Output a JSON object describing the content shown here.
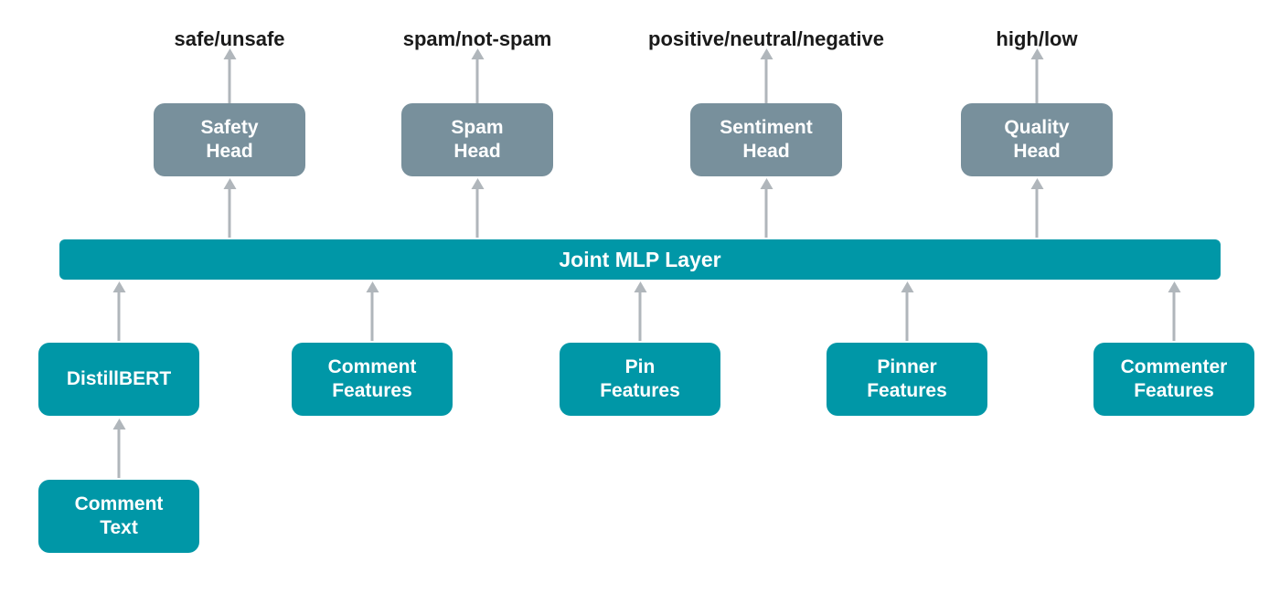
{
  "outputs": {
    "safety": "safe/unsafe",
    "spam": "spam/not-spam",
    "sentiment": "positive/neutral/negative",
    "quality": "high/low"
  },
  "heads": {
    "safety": "Safety\nHead",
    "spam": "Spam\nHead",
    "sentiment": "Sentiment\nHead",
    "quality": "Quality\nHead"
  },
  "joint_layer": "Joint MLP Layer",
  "inputs": {
    "distilbert": "DistillBERT",
    "comment_features": "Comment\nFeatures",
    "pin_features": "Pin\nFeatures",
    "pinner_features": "Pinner\nFeatures",
    "commenter_features": "Commenter\nFeatures"
  },
  "source": {
    "comment_text": "Comment\nText"
  },
  "colors": {
    "teal": "#0097A7",
    "grey": "#78909C",
    "arrow": "#b0b6bb",
    "text": "#1a1a1a"
  }
}
